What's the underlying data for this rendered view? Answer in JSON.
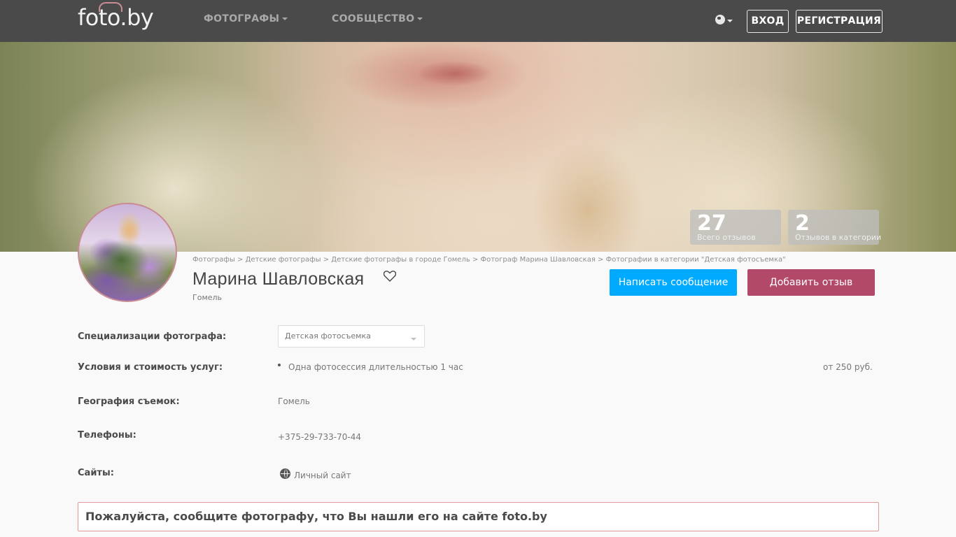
{
  "header": {
    "logo": "foto.by",
    "nav": [
      {
        "label": "ФОТОГРАФЫ"
      },
      {
        "label": "СООБЩЕСТВО"
      }
    ],
    "language_icon": "globe-icon",
    "login_label": "ВХОД",
    "register_label": "РЕГИСТРАЦИЯ"
  },
  "stats": [
    {
      "value": "27",
      "label": "Всего отзывов"
    },
    {
      "value": "2",
      "label": "Отзывов в категории"
    }
  ],
  "breadcrumbs": "Фотографы > Детские фотографы > Детские фотографы в городе Гомель > Фотограф Марина Шавловская > Фотографии в категории \"Детская фотосъемка\"",
  "profile": {
    "name": "Марина Шавловская",
    "city": "Гомель",
    "favorite_icon": "heart-icon"
  },
  "actions": {
    "message_label": "Написать сообщение",
    "review_label": "Добавить отзыв",
    "message_color": "#00aaff",
    "review_color": "#b24968"
  },
  "details": {
    "specializations_label": "Специализации фотографа:",
    "specialization_selected": "Детская фотосъемка",
    "terms_label": "Условия и стоимость услуг:",
    "terms_item": "Одна фотосессия длительностью 1 час",
    "terms_price": "от 250 руб.",
    "geography_label": "География съемок:",
    "geography_value": "Гомель",
    "phones_label": "Телефоны:",
    "phone_value": "+375-29-733-70-44",
    "sites_label": "Сайты:",
    "site_value": "Личный сайт"
  },
  "notice": "Пожалуйста, сообщите фотографу, что Вы нашли его на сайте foto.by"
}
